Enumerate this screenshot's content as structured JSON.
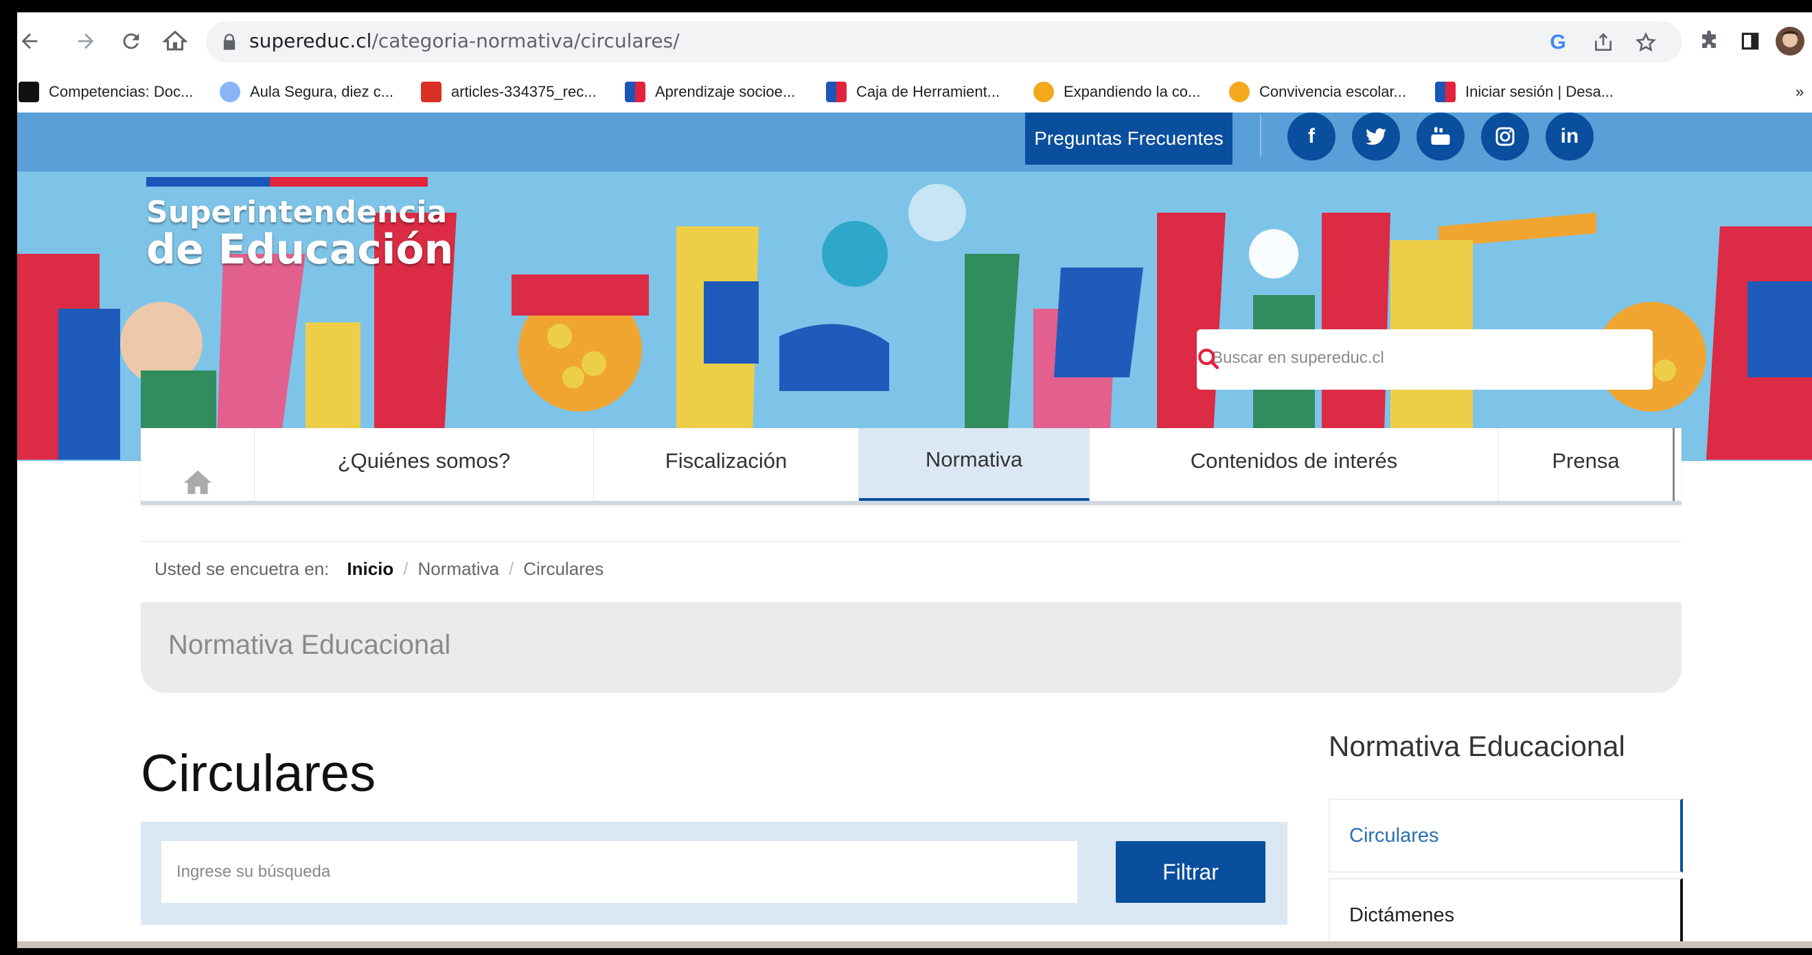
{
  "browser": {
    "url_domain": "supereduc.cl",
    "url_path": "/categoria-normativa/circulares/",
    "bookmarks": [
      {
        "label": "Competencias: Doc...",
        "color": "#000000"
      },
      {
        "label": "Aula Segura, diez c...",
        "color": "#8ab4f8"
      },
      {
        "label": "articles-334375_rec...",
        "color": "#d93025"
      },
      {
        "label": "Aprendizaje socioe...",
        "color": "#1a56b8"
      },
      {
        "label": "Caja de Herramient...",
        "color": "#1a56b8"
      },
      {
        "label": "Expandiendo la co...",
        "color": "#f4a91c"
      },
      {
        "label": "Convivencia escolar...",
        "color": "#f4a91c"
      },
      {
        "label": "Iniciar sesión | Desa...",
        "color": "#1a56b8"
      }
    ],
    "bookmarks_more": "»"
  },
  "header": {
    "faq_button": "Preguntas Frecuentes",
    "social": [
      "facebook-icon",
      "twitter-icon",
      "youtube-icon",
      "instagram-icon",
      "linkedin-icon"
    ],
    "logo_line1": "Superintendencia",
    "logo_line2": "de Educación",
    "search_placeholder": "Buscar en supereduc.cl"
  },
  "nav": {
    "items": [
      "¿Quiénes somos?",
      "Fiscalización",
      "Normativa",
      "Contenidos de interés",
      "Prensa"
    ],
    "active": "Normativa"
  },
  "breadcrumb": {
    "prefix": "Usted se encuetra en:",
    "items": [
      "Inicio",
      "Normativa",
      "Circulares"
    ],
    "separator": "/"
  },
  "section": {
    "title": "Normativa Educacional"
  },
  "main": {
    "title": "Circulares",
    "filter_placeholder": "Ingrese su búsqueda",
    "filter_button": "Filtrar"
  },
  "sidebar": {
    "title": "Normativa Educacional",
    "items": [
      "Circulares",
      "Dictámenes"
    ]
  },
  "colors": {
    "brand_blue": "#0a4f9e",
    "link_blue": "#2a6fb5",
    "gov_red": "#e2233d"
  }
}
